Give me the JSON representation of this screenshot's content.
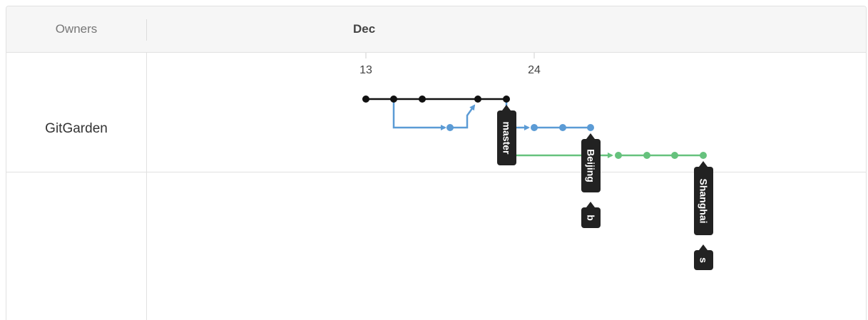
{
  "header": {
    "owners_label": "Owners",
    "month": "Dec"
  },
  "owners": [
    {
      "name": "GitGarden"
    }
  ],
  "timeline": {
    "ticks": [
      {
        "label": "13"
      },
      {
        "label": "24"
      }
    ]
  },
  "colors": {
    "master": "#111111",
    "beijing": "#5b9bd5",
    "shanghai": "#66c27d",
    "tag_bg": "#222222"
  },
  "branches": [
    {
      "name": "master",
      "color": "#111111"
    },
    {
      "name": "Beijing",
      "color": "#5b9bd5"
    },
    {
      "name": "Shanghai",
      "color": "#66c27d"
    }
  ],
  "tags": [
    {
      "label": "master"
    },
    {
      "label": "Beijing"
    },
    {
      "label": "b"
    },
    {
      "label": "Shanghai"
    },
    {
      "label": "s"
    }
  ]
}
